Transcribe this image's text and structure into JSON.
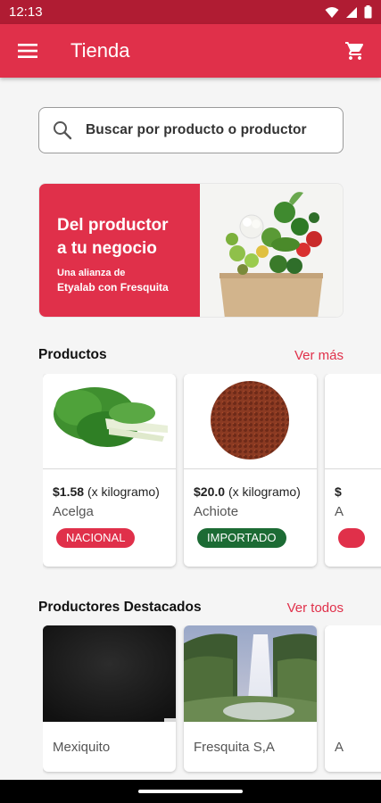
{
  "status_bar": {
    "time": "12:13"
  },
  "app_bar": {
    "title": "Tienda"
  },
  "search": {
    "placeholder": "Buscar por producto o productor"
  },
  "banner": {
    "title_line1": "Del productor",
    "title_line2": "a tu negocio",
    "subtitle_line1": "Una alianza de",
    "subtitle_line2": "Etyalab con Fresquita"
  },
  "products_section": {
    "title": "Productos",
    "link": "Ver más",
    "items": [
      {
        "price": "$1.58",
        "unit": "(x kilogramo)",
        "name": "Acelga",
        "badge": "NACIONAL",
        "badge_color": "#e0304a"
      },
      {
        "price": "$20.0",
        "unit": "(x kilogramo)",
        "name": "Achiote",
        "badge": "IMPORTADO",
        "badge_color": "#1c6b34"
      },
      {
        "price": "$",
        "name": "A"
      }
    ]
  },
  "producers_section": {
    "title": "Productores Destacados",
    "link": "Ver todos",
    "items": [
      {
        "name": "Mexiquito"
      },
      {
        "name": "Fresquita S,A"
      },
      {
        "name": "A"
      }
    ]
  },
  "colors": {
    "primary": "#e0304a",
    "status_bar": "#b01c33",
    "imported_badge": "#1c6b34"
  },
  "icons": [
    "wifi-icon",
    "signal-icon",
    "battery-icon",
    "menu-icon",
    "cart-icon",
    "search-icon"
  ]
}
